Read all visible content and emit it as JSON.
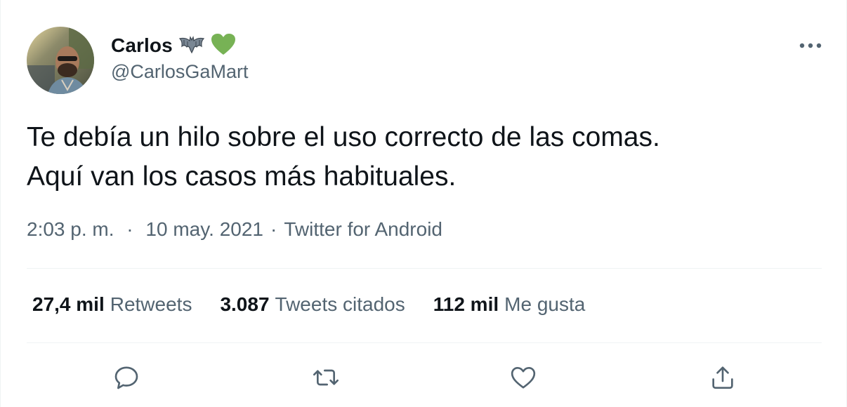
{
  "author": {
    "display_name": "Carlos",
    "handle": "@CarlosGaMart",
    "name_emojis": [
      "bat-emoji",
      "green-heart-emoji"
    ]
  },
  "tweet": {
    "text": "Te debía un hilo sobre el uso correcto de las comas.\nAquí van los casos más habituales.",
    "time": "2:03 p. m.",
    "date": "10 may. 2021",
    "separator": "·",
    "source": "Twitter for Android"
  },
  "stats": {
    "retweets_count": "27,4 mil",
    "retweets_label": "Retweets",
    "quotes_count": "3.087",
    "quotes_label": "Tweets citados",
    "likes_count": "112 mil",
    "likes_label": "Me gusta"
  },
  "actions": [
    "reply-icon",
    "retweet-icon",
    "like-icon",
    "share-icon"
  ],
  "colors": {
    "text_primary": "#0f1419",
    "text_secondary": "#536471",
    "divider": "#eff3f4",
    "heart_emoji": "#77b255"
  }
}
